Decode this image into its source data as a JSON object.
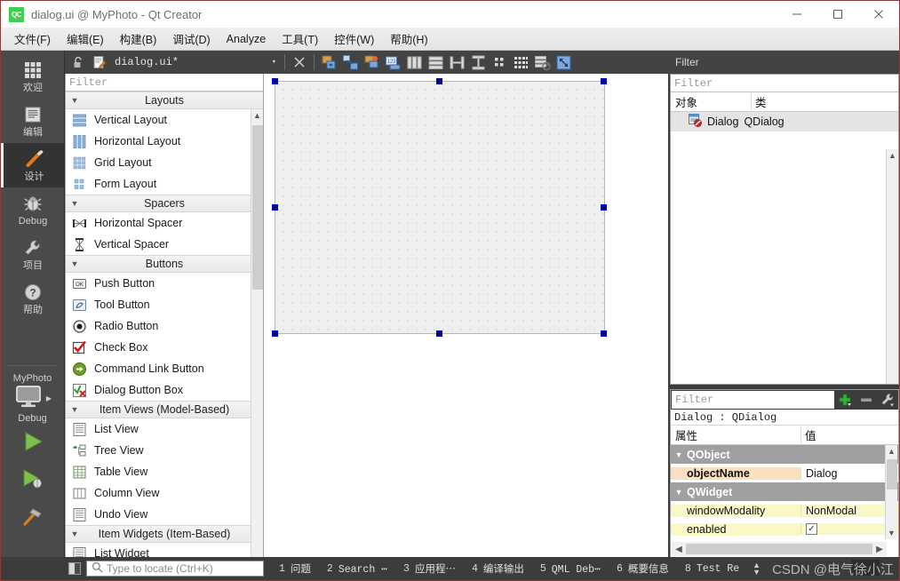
{
  "window": {
    "logo_text": "QC",
    "title": "dialog.ui @ MyPhoto - Qt Creator",
    "minimize_label": "Minimize",
    "maximize_label": "Maximize",
    "close_label": "Close"
  },
  "menubar": {
    "items": [
      {
        "label": "文件(F)",
        "name": "menu-file"
      },
      {
        "label": "编辑(E)",
        "name": "menu-edit"
      },
      {
        "label": "构建(B)",
        "name": "menu-build"
      },
      {
        "label": "调试(D)",
        "name": "menu-debug"
      },
      {
        "label": "Analyze",
        "name": "menu-analyze"
      },
      {
        "label": "工具(T)",
        "name": "menu-tools"
      },
      {
        "label": "控件(W)",
        "name": "menu-window"
      },
      {
        "label": "帮助(H)",
        "name": "menu-help"
      }
    ]
  },
  "activity_bar": {
    "modes": [
      {
        "label": "欢迎",
        "icon": "grid-icon",
        "active": false
      },
      {
        "label": "编辑",
        "icon": "document-lines-icon",
        "active": false
      },
      {
        "label": "设计",
        "icon": "pencil-icon",
        "active": true
      },
      {
        "label": "Debug",
        "icon": "bug-icon",
        "active": false
      },
      {
        "label": "项目",
        "icon": "wrench-icon",
        "active": false
      },
      {
        "label": "帮助",
        "icon": "question-mark-icon",
        "active": false
      }
    ],
    "project": {
      "name": "MyPhoto",
      "kit_icon": "monitor-icon",
      "build_config": "Debug"
    },
    "run_buttons": [
      {
        "name": "run-button",
        "icon": "green-play-icon"
      },
      {
        "name": "debug-button",
        "icon": "green-play-bug-icon"
      },
      {
        "name": "build-button",
        "icon": "hammer-icon"
      }
    ]
  },
  "editor_toolbar": {
    "lock_icon": "unlock-icon",
    "file_icon": "ui-file-icon",
    "file_name": "dialog.ui*",
    "dropdown_arrow": "▾",
    "close_label": "×",
    "tools": [
      {
        "name": "edit-widgets-tool",
        "icon": "edit-widgets-icon"
      },
      {
        "name": "edit-signals-slots-tool",
        "icon": "signals-slots-icon"
      },
      {
        "name": "edit-buddies-tool",
        "icon": "buddies-icon"
      },
      {
        "name": "edit-tab-order-tool",
        "icon": "tab-order-icon"
      },
      {
        "name": "layout-horizontally-tool",
        "icon": "layout-horizontal-icon"
      },
      {
        "name": "layout-vertically-tool",
        "icon": "layout-vertical-icon"
      },
      {
        "name": "layout-splitter-horizontal-tool",
        "icon": "splitter-horizontal-icon"
      },
      {
        "name": "layout-splitter-vertical-tool",
        "icon": "splitter-vertical-icon"
      },
      {
        "name": "layout-form-tool",
        "icon": "form-layout-icon"
      },
      {
        "name": "layout-grid-tool",
        "icon": "grid-layout-icon"
      },
      {
        "name": "break-layout-tool",
        "icon": "break-layout-icon"
      },
      {
        "name": "adjust-size-tool",
        "icon": "adjust-size-icon"
      }
    ]
  },
  "widget_box": {
    "filter_placeholder": "Filter",
    "groups": [
      {
        "label": "Layouts",
        "name": "widget-group-layouts",
        "items": [
          {
            "label": "Vertical Layout",
            "icon": "vertical-layout-icon"
          },
          {
            "label": "Horizontal Layout",
            "icon": "horizontal-layout-icon"
          },
          {
            "label": "Grid Layout",
            "icon": "grid-layout-icon"
          },
          {
            "label": "Form Layout",
            "icon": "form-layout-icon"
          }
        ]
      },
      {
        "label": "Spacers",
        "name": "widget-group-spacers",
        "items": [
          {
            "label": "Horizontal Spacer",
            "icon": "horizontal-spacer-icon"
          },
          {
            "label": "Vertical Spacer",
            "icon": "vertical-spacer-icon"
          }
        ]
      },
      {
        "label": "Buttons",
        "name": "widget-group-buttons",
        "items": [
          {
            "label": "Push Button",
            "icon": "push-button-icon"
          },
          {
            "label": "Tool Button",
            "icon": "tool-button-icon"
          },
          {
            "label": "Radio Button",
            "icon": "radio-button-icon"
          },
          {
            "label": "Check Box",
            "icon": "check-box-icon"
          },
          {
            "label": "Command Link Button",
            "icon": "command-link-icon"
          },
          {
            "label": "Dialog Button Box",
            "icon": "dialog-button-box-icon"
          }
        ]
      },
      {
        "label": "Item Views (Model-Based)",
        "name": "widget-group-item-views",
        "items": [
          {
            "label": "List View",
            "icon": "list-view-icon"
          },
          {
            "label": "Tree View",
            "icon": "tree-view-icon"
          },
          {
            "label": "Table View",
            "icon": "table-view-icon"
          },
          {
            "label": "Column View",
            "icon": "column-view-icon"
          },
          {
            "label": "Undo View",
            "icon": "undo-view-icon"
          }
        ]
      },
      {
        "label": "Item Widgets (Item-Based)",
        "name": "widget-group-item-widgets",
        "items": [
          {
            "label": "List Widget",
            "icon": "list-widget-icon"
          }
        ]
      }
    ]
  },
  "object_inspector": {
    "panel_title": "Filter",
    "filter_placeholder": "Filter",
    "columns": [
      "对象",
      "类"
    ],
    "rows": [
      {
        "object": "Dialog",
        "class": "QDialog",
        "icon": "dialog-icon"
      }
    ]
  },
  "property_editor": {
    "filter_placeholder": "Filter",
    "add_label": "+",
    "remove_label": "−",
    "config_icon": "wrench-icon",
    "object_line": "Dialog : QDialog",
    "columns": [
      "属性",
      "值"
    ],
    "groups": [
      {
        "name": "QObject",
        "properties": [
          {
            "key": "objectName",
            "value": "Dialog",
            "style": "selected",
            "type": "text"
          }
        ]
      },
      {
        "name": "QWidget",
        "properties": [
          {
            "key": "windowModality",
            "value": "NonModal",
            "style": "yellow",
            "type": "text"
          },
          {
            "key": "enabled",
            "value": "✓",
            "style": "yellow",
            "type": "checkbox"
          }
        ]
      }
    ]
  },
  "canvas": {
    "form_name": "Dialog",
    "selected": true
  },
  "status_bar": {
    "locator_placeholder": "Type to locate (Ctrl+K)",
    "search_icon": "search-icon",
    "tabs": [
      {
        "num": "1",
        "label": "问题",
        "mono": false
      },
      {
        "num": "2",
        "label": "Search ⋯",
        "mono": true
      },
      {
        "num": "3",
        "label": "应用程⋯",
        "mono": false
      },
      {
        "num": "4",
        "label": "编译输出",
        "mono": false
      },
      {
        "num": "5",
        "label": "QML Deb⋯",
        "mono": true
      },
      {
        "num": "6",
        "label": "概要信息",
        "mono": false
      },
      {
        "num": "8",
        "label": "Test Re",
        "mono": true
      }
    ],
    "watermark": "CSDN @电气徐小江"
  }
}
